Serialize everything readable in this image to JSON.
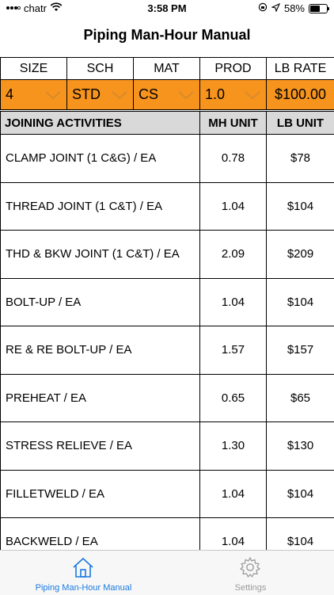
{
  "status": {
    "carrier": "chatr",
    "time": "3:58 PM",
    "battery": "58%"
  },
  "nav": {
    "title": "Piping Man-Hour Manual"
  },
  "header": {
    "cols": [
      "SIZE",
      "SCH",
      "MAT",
      "PROD",
      "LB RATE"
    ]
  },
  "selectors": {
    "size": "4",
    "sch": "STD",
    "mat": "CS",
    "prod": "1.0",
    "lb_rate": "$100.00"
  },
  "table": {
    "headers": [
      "JOINING ACTIVITIES",
      "MH UNIT",
      "LB UNIT"
    ],
    "rows": [
      {
        "activity": "CLAMP JOINT  (1 C&G)  / EA",
        "mh": "0.78",
        "lb": "$78"
      },
      {
        "activity": "THREAD JOINT  (1 C&T)  / EA",
        "mh": "1.04",
        "lb": "$104"
      },
      {
        "activity": "THD & BKW JOINT  (1 C&T)  / EA",
        "mh": "2.09",
        "lb": "$209"
      },
      {
        "activity": "BOLT-UP  / EA",
        "mh": "1.04",
        "lb": "$104"
      },
      {
        "activity": "RE & RE  BOLT-UP  / EA",
        "mh": "1.57",
        "lb": "$157"
      },
      {
        "activity": "PREHEAT  / EA",
        "mh": "0.65",
        "lb": "$65"
      },
      {
        "activity": "STRESS RELIEVE  / EA",
        "mh": "1.30",
        "lb": "$130"
      },
      {
        "activity": "FILLETWELD  / EA",
        "mh": "1.04",
        "lb": "$104"
      },
      {
        "activity": "BACKWELD  / EA",
        "mh": "1.04",
        "lb": "$104"
      }
    ]
  },
  "tabs": [
    {
      "label": "Piping Man-Hour Manual",
      "icon": "home-icon",
      "active": true
    },
    {
      "label": "Settings",
      "icon": "gear-icon",
      "active": false
    }
  ],
  "colors": {
    "accent": "#f7941d",
    "header_gray": "#d9d9d9",
    "tab_active": "#1a7ae0",
    "tab_inactive": "#9b9b9b",
    "chevron": "#d98a2b"
  }
}
